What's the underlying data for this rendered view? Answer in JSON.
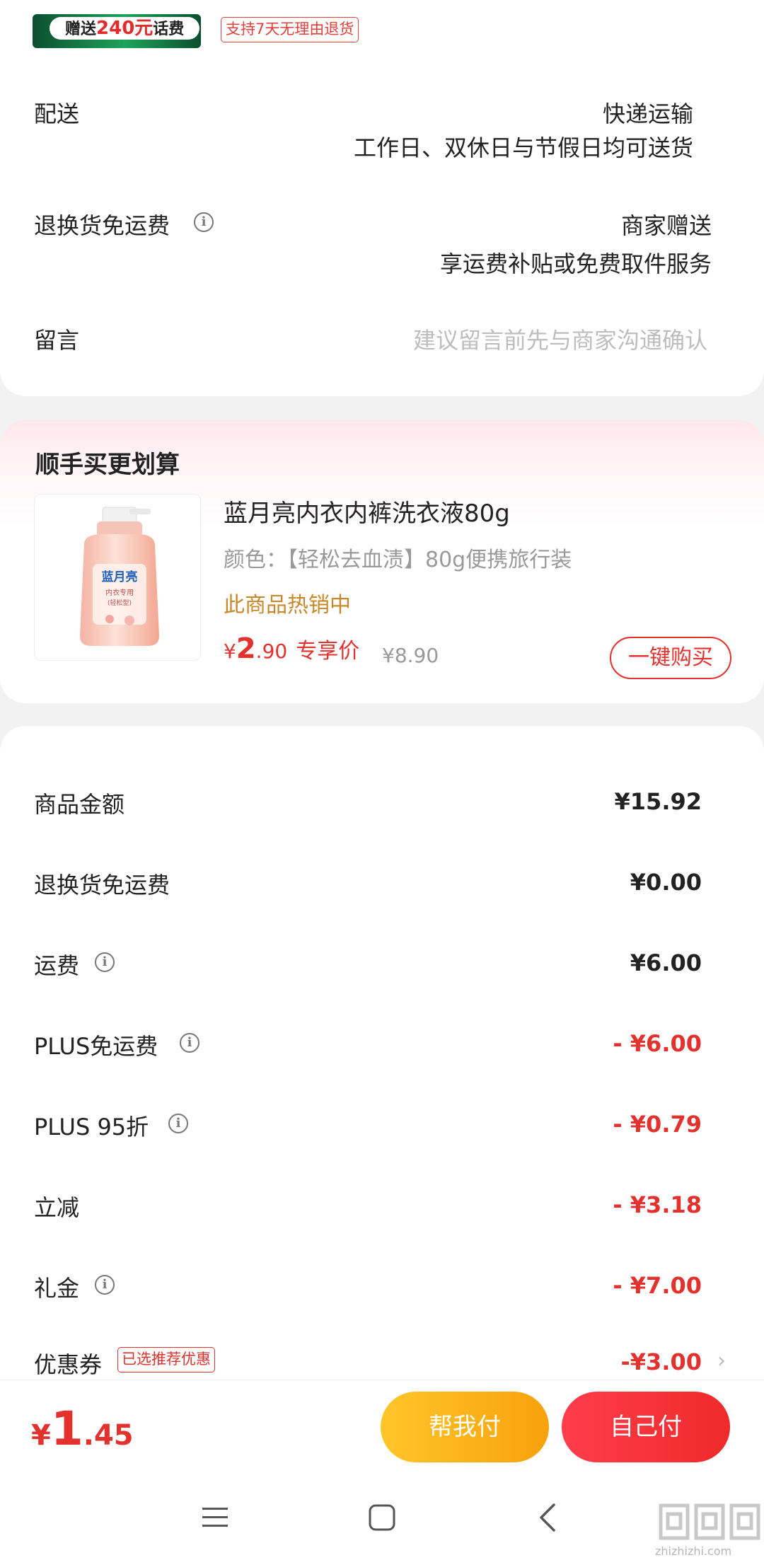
{
  "top_badges": {
    "gift_prefix": "赠送",
    "gift_amount": "240元",
    "gift_suffix": "话费",
    "return_policy": "支持7天无理由退货"
  },
  "delivery": {
    "label": "配送",
    "method": "快递运输",
    "schedule": "工作日、双休日与节假日均可送货"
  },
  "return_shipping": {
    "label": "退换货免运费",
    "value": "商家赠送",
    "detail": "享运费补贴或免费取件服务"
  },
  "message": {
    "label": "留言",
    "placeholder": "建议留言前先与商家沟通确认"
  },
  "upsell": {
    "title": "顺手买更划算",
    "product_title": "蓝月亮内衣内裤洗衣液80g",
    "spec": "颜色：【轻松去血渍】80g便携旅行装",
    "hot": "此商品热销中",
    "price_symbol": "¥",
    "price_int": "2",
    "price_dec": ".90",
    "price_tag": "专享价",
    "original_price": "¥8.90",
    "buy_button": "一键购买",
    "bottle_brand": "蓝月亮",
    "bottle_line1": "内衣专用",
    "bottle_line2": "(轻松型)"
  },
  "summary": [
    {
      "label": "商品金额",
      "amount": "¥15.92"
    },
    {
      "label": "退换货免运费",
      "amount": "¥0.00"
    },
    {
      "label": "运费",
      "amount": "¥6.00"
    },
    {
      "label": "PLUS免运费",
      "amount": "- ¥6.00"
    },
    {
      "label": "PLUS 95折",
      "amount": "- ¥0.79"
    },
    {
      "label": "立减",
      "amount": "- ¥3.18"
    },
    {
      "label": "礼金",
      "amount": "- ¥7.00"
    },
    {
      "label": "优惠券",
      "tag": "已选推荐优惠",
      "amount": "-¥3.00"
    }
  ],
  "footer": {
    "total_symbol": "¥",
    "total_int": "1",
    "total_dec": ".45",
    "help_pay": "帮我付",
    "self_pay": "自己付"
  },
  "watermark": {
    "domain": "zhizhizhi.com"
  },
  "colors": {
    "accent_red": "#e3312d",
    "hot_gold": "#c8882a",
    "help_button": "#ffc52a",
    "self_button": "#ff3d4b"
  }
}
